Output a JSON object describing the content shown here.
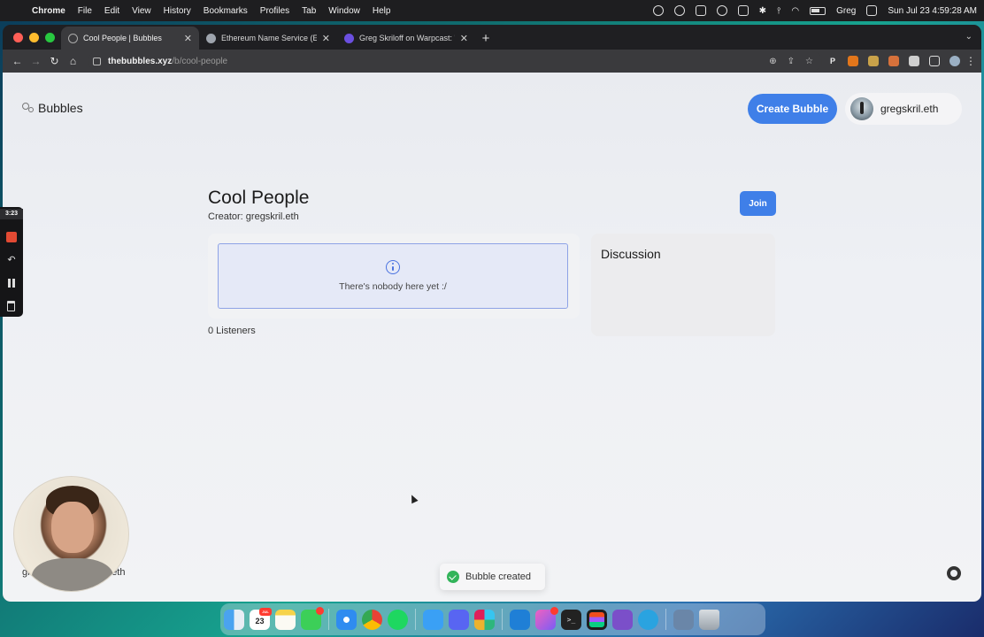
{
  "menubar": {
    "app_name": "Chrome",
    "items": [
      "File",
      "Edit",
      "View",
      "History",
      "Bookmarks",
      "Profiles",
      "Tab",
      "Window",
      "Help"
    ],
    "user": "Greg",
    "clock": "Sun Jul 23  4:59:28 AM"
  },
  "browser": {
    "tabs": [
      {
        "title": "Cool People | Bubbles",
        "icon": "bubbles-favicon",
        "active": true
      },
      {
        "title": "Ethereum Name Service (ENS)",
        "icon": "ens-favicon",
        "active": false
      },
      {
        "title": "Greg Skriloff on Warpcast: \"@",
        "icon": "warpcast-favicon",
        "active": false
      }
    ],
    "url_host": "thebubbles.xyz",
    "url_path": "/b/cool-people"
  },
  "page": {
    "brand": "Bubbles",
    "create_button": "Create Bubble",
    "user_name": "gregskril.eth",
    "bubble_title": "Cool People",
    "creator": "Creator: gregskril.eth",
    "join_button": "Join",
    "empty_state": "There's nobody here yet :/",
    "listener_count": "0 Listeners",
    "discussion_title": "Discussion",
    "footer_user_start": "gr",
    "footer_user_end": "one.eth",
    "toast": "Bubble created"
  },
  "recording": {
    "time": "3:23"
  },
  "dock": {
    "calendar_day": "23",
    "calendar_month": "JUL"
  },
  "colors": {
    "accent": "#3f7fe8",
    "success": "#33b45a",
    "info_border": "#8ea3e6"
  }
}
